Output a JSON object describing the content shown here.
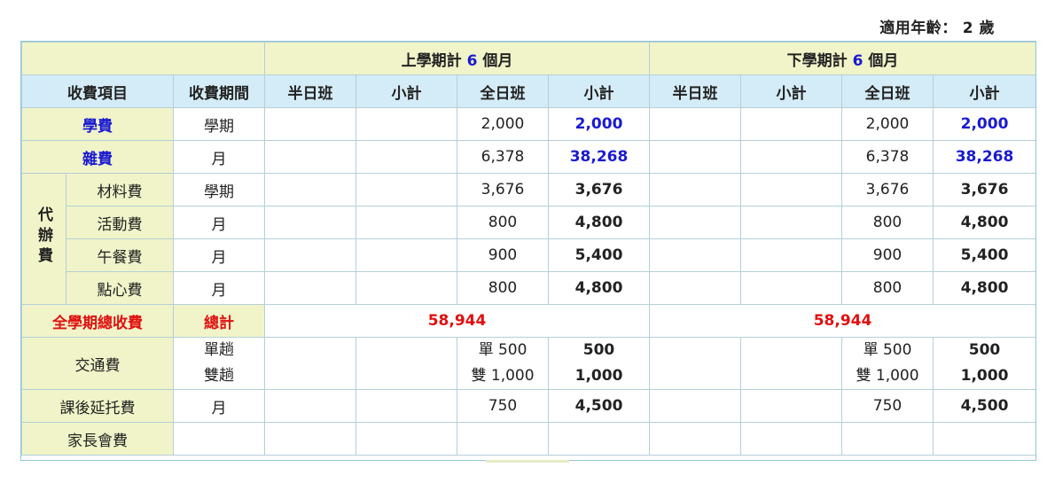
{
  "age_note": {
    "label": "適用年齡：",
    "value": "2",
    "unit": "歲"
  },
  "semesters": [
    {
      "prefix": "上學期計 ",
      "months": "6",
      "suffix": " 個月"
    },
    {
      "prefix": "下學期計 ",
      "months": "6",
      "suffix": " 個月"
    }
  ],
  "columns": {
    "item": "收費項目",
    "period": "收費期間",
    "half_day": "半日班",
    "subtotal": "小計",
    "full_day": "全日班"
  },
  "group_label": "代辦費",
  "rows": {
    "tuition": {
      "name": "學費",
      "period": "學期",
      "full": "2,000",
      "sub": "2,000"
    },
    "misc": {
      "name": "雜費",
      "period": "月",
      "full": "6,378",
      "sub": "38,268"
    },
    "materials": {
      "name": "材料費",
      "period": "學期",
      "full": "3,676",
      "sub": "3,676"
    },
    "activity": {
      "name": "活動費",
      "period": "月",
      "full": "800",
      "sub": "4,800"
    },
    "lunch": {
      "name": "午餐費",
      "period": "月",
      "full": "900",
      "sub": "5,400"
    },
    "snack": {
      "name": "點心費",
      "period": "月",
      "full": "800",
      "sub": "4,800"
    },
    "total": {
      "name": "全學期總收費",
      "period": "總計",
      "value": "58,944"
    },
    "transport": {
      "name": "交通費",
      "period_single": "單趟",
      "period_double": "雙趟",
      "full_single": "單 500",
      "full_double": "雙 1,000",
      "sub_single": "500",
      "sub_double": "1,000"
    },
    "aftercare": {
      "name": "課後延托費",
      "period": "月",
      "full": "750",
      "sub": "4,500"
    },
    "parents": {
      "name": "家長會費"
    }
  },
  "colors": {
    "header_yellow": "#f0f4c8",
    "header_blue": "#d4ecf7",
    "border": "#b5cfd9",
    "accent_blue": "#1a1ad0",
    "accent_red": "#e01010"
  }
}
